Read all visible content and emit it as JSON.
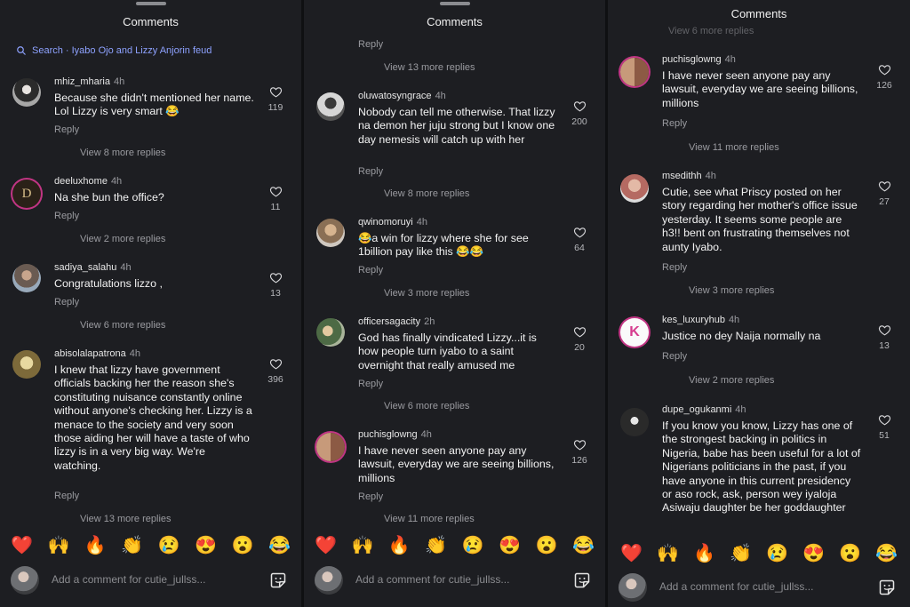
{
  "header_title": "Comments",
  "search_text": "Search · Iyabo Ojo and Lizzy Anjorin feud",
  "reply_label": "Reply",
  "composer_placeholder": "Add a comment for cutie_jullss...",
  "emojis": [
    "❤️",
    "🙌",
    "🔥",
    "👏",
    "😢",
    "😍",
    "😮",
    "😂"
  ],
  "panel1": {
    "comments": [
      {
        "user": "mhiz_mharia",
        "time": "4h",
        "text": "Because she didn't mentioned her name. Lol Lizzy is very smart 😂",
        "likes": "119",
        "more": "View 8 more replies"
      },
      {
        "user": "deeluxhome",
        "time": "4h",
        "text": "Na she bun the office?",
        "likes": "11",
        "more": "View 2 more replies"
      },
      {
        "user": "sadiya_salahu",
        "time": "4h",
        "text": "Congratulations lizzo ,",
        "likes": "13",
        "more": "View 6 more replies"
      },
      {
        "user": "abisolalapatrona",
        "time": "4h",
        "text": "I knew that lizzy have government officials backing her the reason she's constituting nuisance constantly online without anyone's checking her. Lizzy is a menace to the society and very soon those aiding her will have a taste of who lizzy is in a very big way. We're watching.",
        "likes": "396",
        "more": "View 13 more replies"
      }
    ]
  },
  "panel2": {
    "top_reply": "Reply",
    "top_more": "View 13 more replies",
    "comments": [
      {
        "user": "oluwatosyngrace",
        "time": "4h",
        "text": "Nobody can tell me otherwise. That lizzy na demon her juju strong but I know one day nemesis will catch up with her",
        "likes": "200",
        "more": "View 8 more replies"
      },
      {
        "user": "qwinomoruyi",
        "time": "4h",
        "text": "😂a win for lizzy where she for see 1billion pay like this 😂😂",
        "likes": "64",
        "more": "View 3 more replies"
      },
      {
        "user": "officersagacity",
        "time": "2h",
        "text": "God has finally vindicated Lizzy...it is how people turn iyabo to a saint overnight that really amused me",
        "likes": "20",
        "more": "View 6 more replies"
      },
      {
        "user": "puchisglowng",
        "time": "4h",
        "text": "I have never seen anyone pay any lawsuit, everyday we are seeing billions, millions",
        "likes": "126",
        "more": "View 11 more replies"
      }
    ]
  },
  "panel3": {
    "top_more": "View 6 more replies",
    "comments": [
      {
        "user": "puchisglowng",
        "time": "4h",
        "text": "I have never seen anyone pay any lawsuit, everyday we are seeing billions, millions",
        "likes": "126",
        "more": "View 11 more replies"
      },
      {
        "user": "msedithh",
        "time": "4h",
        "text": "Cutie, see what Priscy posted on her story regarding her mother's office issue yesterday. It seems some people are h3!! bent on frustrating themselves not aunty Iyabo.",
        "likes": "27",
        "more": "View 3 more replies"
      },
      {
        "user": "kes_luxuryhub",
        "time": "4h",
        "text": "Justice no dey Naija normally na",
        "likes": "13",
        "more": "View 2 more replies"
      },
      {
        "user": "dupe_ogukanmi",
        "time": "4h",
        "text": "If you know you know, Lizzy has one of the strongest backing in politics in Nigeria, babe has been useful for a lot of Nigerians politicians in the past, if you have anyone in this current presidency or aso rock, ask, person wey iyaloja Asiwaju daughter be her goddaughter",
        "likes": "51"
      }
    ]
  }
}
